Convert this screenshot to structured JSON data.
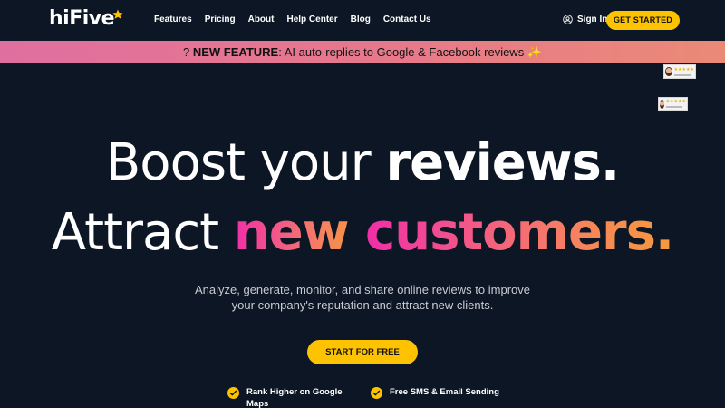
{
  "brand": {
    "name": "hiFive",
    "accent": "#fdc200"
  },
  "nav": {
    "links": [
      "Features",
      "Pricing",
      "About",
      "Help Center",
      "Blog",
      "Contact Us"
    ],
    "signin_label": "Sign In",
    "cta_label": "GET STARTED"
  },
  "banner": {
    "prefix": "? ",
    "bold": "NEW FEATURE",
    "text": ": AI auto-replies to Google & Facebook reviews ",
    "emoji": "✨"
  },
  "hero": {
    "line1_thin": "Boost your ",
    "line1_bold": "reviews.",
    "line2_thin": "Attract ",
    "line2_pink": "new ",
    "line2_grad": "customers.",
    "subtitle_line1": "Analyze, generate, monitor, and share online reviews to improve",
    "subtitle_line2": "your company's reputation and attract new clients.",
    "cta_label": "START FOR FREE"
  },
  "features": [
    {
      "label_line1": "Rank Higher on Google",
      "label_line2": "Maps"
    },
    {
      "label_line1": "Free SMS & Email Sending",
      "label_line2": ""
    }
  ]
}
